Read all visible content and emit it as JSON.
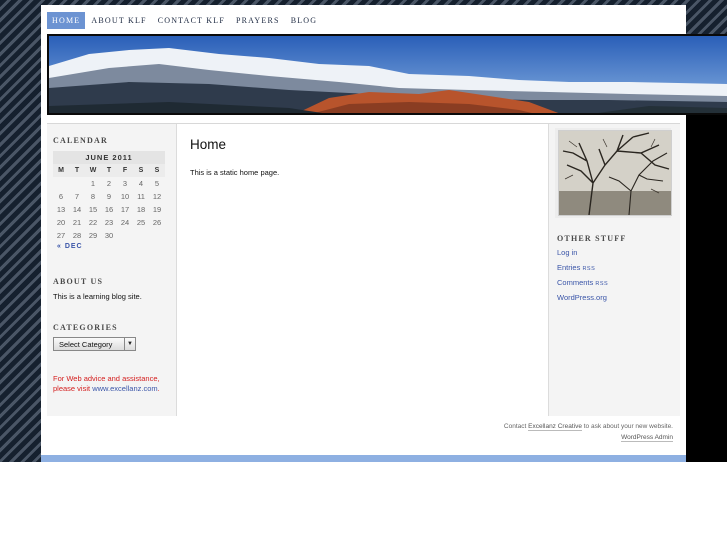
{
  "nav": [
    "Home",
    "About KLF",
    "Contact KLF",
    "Prayers",
    "Blog"
  ],
  "calendar": {
    "title": "Calendar",
    "month": "June 2011",
    "days": [
      "M",
      "T",
      "W",
      "T",
      "F",
      "S",
      "S"
    ],
    "weeks": [
      [
        "",
        "",
        "1",
        "2",
        "3",
        "4",
        "5"
      ],
      [
        "6",
        "7",
        "8",
        "9",
        "10",
        "11",
        "12"
      ],
      [
        "13",
        "14",
        "15",
        "16",
        "17",
        "18",
        "19"
      ],
      [
        "20",
        "21",
        "22",
        "23",
        "24",
        "25",
        "26"
      ],
      [
        "27",
        "28",
        "29",
        "30",
        "",
        "",
        ""
      ]
    ],
    "prev_link": "« Dec"
  },
  "about": {
    "title": "About Us",
    "text": "This is a learning blog site."
  },
  "categories": {
    "title": "Categories",
    "select_value": "Select Category"
  },
  "advice": {
    "text": "For Web advice and assistance, please visit ",
    "link": "www.excellanz.com",
    "end": "."
  },
  "main": {
    "heading": "Home",
    "text": "This is a static home page."
  },
  "other_stuff": {
    "title": "Other Stuff",
    "items": [
      {
        "label": "Log in",
        "rss": ""
      },
      {
        "label": "Entries ",
        "rss": "RSS"
      },
      {
        "label": "Comments ",
        "rss": "RSS"
      },
      {
        "label": "WordPress.org",
        "rss": ""
      }
    ]
  },
  "footer": {
    "line1_pre": "Contact ",
    "line1_link": "Excellanz Creative",
    "line1_post": " to ask about your new website.",
    "admin": "WordPress Admin"
  },
  "colors": {
    "nav_active": "#6c93d2",
    "link": "#3a55a8",
    "advice": "#d42020"
  },
  "icons": {
    "select_arrow": "chevron-down-icon"
  }
}
